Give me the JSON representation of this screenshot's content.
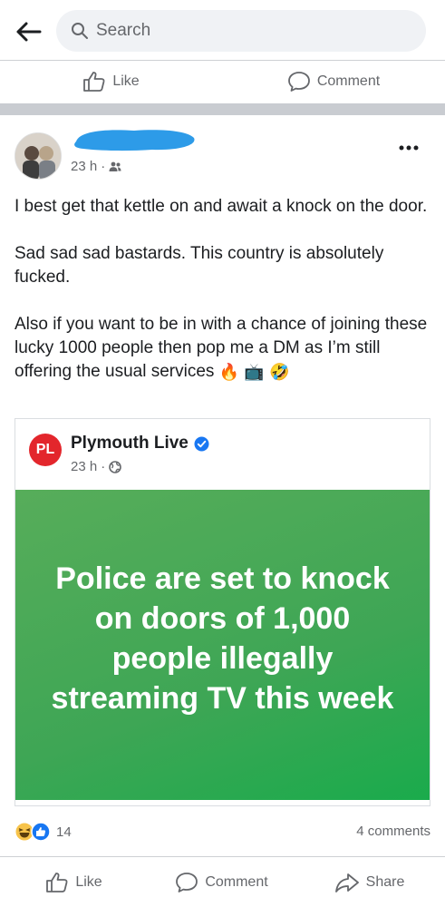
{
  "search": {
    "placeholder": "Search"
  },
  "previous_post_actions": {
    "like": "Like",
    "comment": "Comment"
  },
  "post": {
    "time": "23 h",
    "paragraphs": [
      "I best get that kettle on and await a knock on the door.",
      "Sad sad sad bastards. This country is absolutely fucked.",
      "Also if you want to be in with a chance of joining these lucky 1000 people then pop me a DM as I’m still offering the usual services"
    ],
    "emojis": [
      "🔥",
      "📺",
      "🤣"
    ],
    "shared": {
      "logo_text": "PL",
      "page_name": "Plymouth Live",
      "time": "23 h",
      "headline": "Police are set to knock on doors of 1,000 people illegally streaming TV this week"
    },
    "reactions_count": "14",
    "comments_count": "4 comments",
    "actions": {
      "like": "Like",
      "comment": "Comment",
      "share": "Share"
    }
  },
  "colors": {
    "accent": "#1877f2",
    "banner_green": "#3ea655",
    "pl_red": "#e3262c",
    "redaction_blue": "#2d9be8"
  },
  "icons": [
    "back-arrow-icon",
    "search-icon",
    "like-icon",
    "comment-icon",
    "friends-icon",
    "globe-icon",
    "verified-icon",
    "share-icon",
    "more-icon"
  ]
}
